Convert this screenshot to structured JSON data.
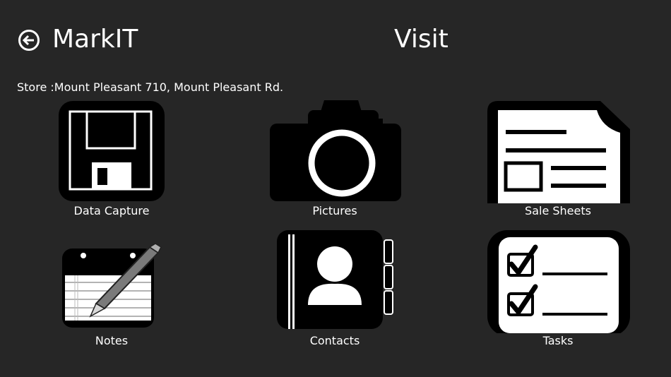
{
  "header": {
    "app_title": "MarkIT",
    "page_title": "Visit"
  },
  "store": {
    "text": "Store :Mount Pleasant 710, Mount Pleasant Rd."
  },
  "tiles": [
    {
      "label": "Data Capture",
      "icon": "floppy-disk-icon"
    },
    {
      "label": "Pictures",
      "icon": "camera-icon"
    },
    {
      "label": "Sale Sheets",
      "icon": "document-icon"
    },
    {
      "label": "Notes",
      "icon": "notepad-pencil-icon"
    },
    {
      "label": "Contacts",
      "icon": "address-book-icon"
    },
    {
      "label": "Tasks",
      "icon": "checklist-icon"
    }
  ],
  "colors": {
    "background": "#262626",
    "foreground": "#ffffff",
    "icon_dark": "#000000"
  }
}
